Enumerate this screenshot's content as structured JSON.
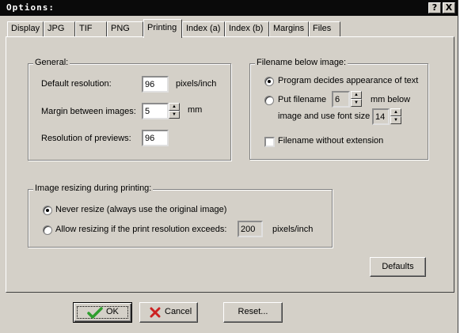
{
  "window": {
    "title": "Options:"
  },
  "titlebar": {
    "help_label": "?",
    "close_label": "X"
  },
  "tabs": [
    "Display",
    "JPG",
    "TIF",
    "PNG",
    "Printing",
    "Index (a)",
    "Index (b)",
    "Margins",
    "Files"
  ],
  "active_tab": "Printing",
  "general": {
    "legend": "General:",
    "default_resolution_label": "Default resolution:",
    "default_resolution_value": "96",
    "default_resolution_unit": "pixels/inch",
    "margin_label": "Margin between images:",
    "margin_value": "5",
    "margin_unit": "mm",
    "preview_label": "Resolution of previews:",
    "preview_value": "96"
  },
  "filename": {
    "legend": "Filename below image:",
    "option1_label": "Program decides appearance of text",
    "option1_checked": true,
    "option2_label": "Put filename",
    "option2_mm_value": "6",
    "option2_mm_label": "mm below",
    "option2_font_label": "image and use font size",
    "option2_font_value": "14",
    "without_ext_label": "Filename without extension",
    "without_ext_checked": false
  },
  "resizing": {
    "legend": "Image resizing during printing:",
    "never_label": "Never resize (always use the original image)",
    "never_checked": true,
    "allow_label": "Allow resizing if the print resolution exceeds:",
    "allow_value": "200",
    "allow_unit": "pixels/inch"
  },
  "buttons": {
    "defaults": "Defaults",
    "ok": "OK",
    "cancel": "Cancel",
    "reset": "Reset..."
  },
  "icons": {
    "ok": "checkmark-icon",
    "cancel": "cross-icon"
  },
  "colors": {
    "face": "#d4d0c8",
    "titlebar": "#0a0a0a",
    "ok_icon": "#2e9e2e",
    "cancel_icon": "#cc2222"
  }
}
